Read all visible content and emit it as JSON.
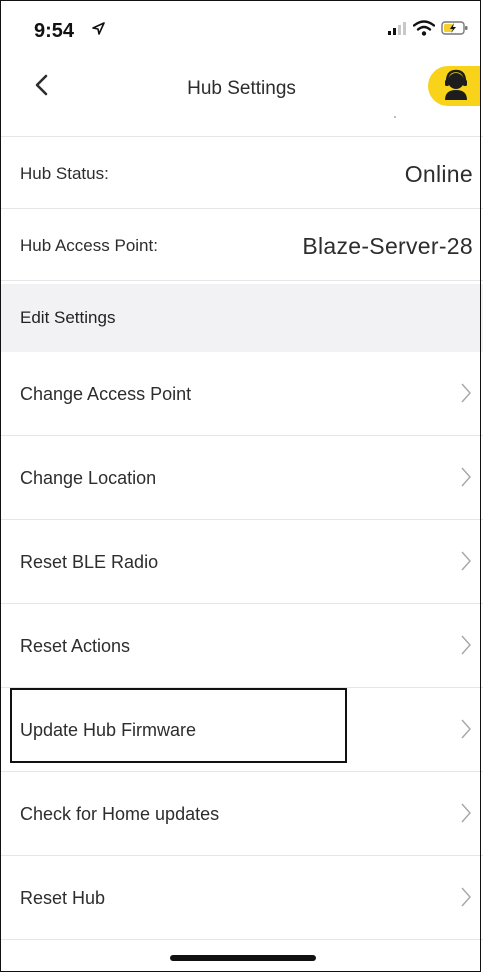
{
  "status_bar": {
    "time": "9:54"
  },
  "nav": {
    "title": "Hub Settings"
  },
  "info": [
    {
      "label": "Hub Status:",
      "value": "Online"
    },
    {
      "label": "Hub Access Point:",
      "value": "Blaze-Server-28"
    }
  ],
  "section": {
    "title": "Edit Settings"
  },
  "menu": [
    {
      "label": "Change Access Point"
    },
    {
      "label": "Change Location"
    },
    {
      "label": "Reset BLE Radio"
    },
    {
      "label": "Reset Actions"
    },
    {
      "label": "Update Hub Firmware"
    },
    {
      "label": "Check for Home updates"
    },
    {
      "label": "Reset Hub"
    }
  ],
  "colors": {
    "accent": "#f9d21a",
    "section_bg": "#f2f2f4",
    "separator": "#e6e6e6"
  },
  "icons": {
    "back": "chevron-left-icon",
    "support": "support-agent-icon",
    "row": "chevron-right-icon"
  }
}
